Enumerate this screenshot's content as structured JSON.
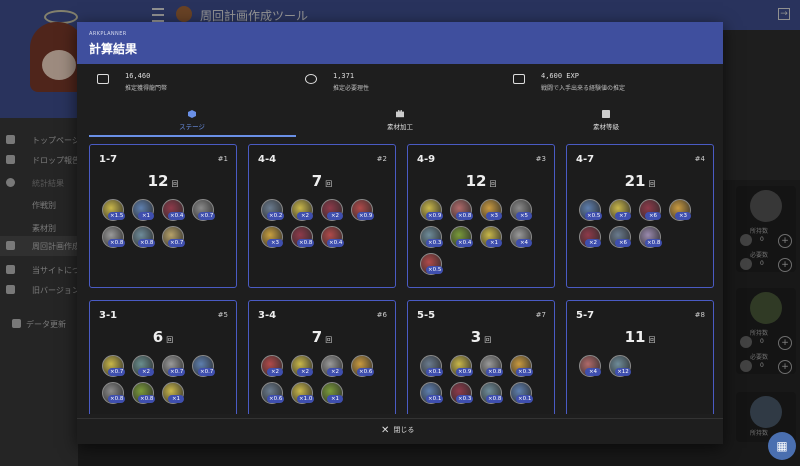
{
  "app": {
    "title": "周回計画作成ツール"
  },
  "drawer": {
    "items": [
      {
        "label": "トップページ",
        "icon": "home-icon"
      },
      {
        "label": "ドロップ報告",
        "icon": "upload-icon"
      },
      {
        "label": "統計結果",
        "icon": "pie-chart-icon"
      },
      {
        "label": "作戦別",
        "icon": ""
      },
      {
        "label": "素材別",
        "icon": ""
      },
      {
        "label": "周回計画作成ツ",
        "icon": "calculator-icon"
      },
      {
        "label": "当サイトについ",
        "icon": "people-icon"
      },
      {
        "label": "旧バージョン",
        "icon": "history-icon"
      },
      {
        "label": "データ更新",
        "icon": "database-icon"
      }
    ]
  },
  "right_panel": {
    "owned_label": "所持数",
    "required_label": "必要数",
    "value": "0"
  },
  "dialog": {
    "brand": "ARKPLANNER",
    "title": "計算結果",
    "stats": [
      {
        "value": "16,460",
        "label": "推定獲得龍門幣",
        "icon": "money-icon"
      },
      {
        "value": "1,371",
        "label": "推定必要理性",
        "icon": "sanity-icon"
      },
      {
        "value": "4,600 EXP",
        "label": "戦闘で入手出来る経験値の推定",
        "icon": "exp-icon"
      }
    ],
    "tabs": [
      {
        "label": "ステージ",
        "icon": "cube-icon"
      },
      {
        "label": "素材加工",
        "icon": "toolbox-icon"
      },
      {
        "label": "素材等級",
        "icon": "grade-icon"
      }
    ],
    "times_unit": "回",
    "stages": [
      {
        "code": "1-7",
        "index": "#1",
        "count": "12",
        "drops": [
          {
            "badge": "×1.5",
            "color": "#c9b74a"
          },
          {
            "badge": "×1",
            "color": "#5e7fae"
          },
          {
            "badge": "×0.4",
            "color": "#8e3a4a"
          },
          {
            "badge": "×0.7",
            "color": "#8a8a8a"
          },
          {
            "badge": "×0.8",
            "color": "#9a9a9a"
          },
          {
            "badge": "×0.8",
            "color": "#6f8c9a"
          },
          {
            "badge": "×0.7",
            "color": "#b7a26a"
          }
        ]
      },
      {
        "code": "4-4",
        "index": "#2",
        "count": "7",
        "drops": [
          {
            "badge": "×0.2",
            "color": "#6a7b8e"
          },
          {
            "badge": "×2",
            "color": "#c9b74a"
          },
          {
            "badge": "×2",
            "color": "#8e3a4a"
          },
          {
            "badge": "×0.9",
            "color": "#b04a4a"
          },
          {
            "badge": "×3",
            "color": "#c9a040"
          },
          {
            "badge": "×0.8",
            "color": "#8e3a4a"
          },
          {
            "badge": "×0.4",
            "color": "#b04a4a"
          }
        ]
      },
      {
        "code": "4-9",
        "index": "#3",
        "count": "12",
        "drops": [
          {
            "badge": "×0.9",
            "color": "#c9b74a"
          },
          {
            "badge": "×0.8",
            "color": "#b06a6a"
          },
          {
            "badge": "×3",
            "color": "#c99a40"
          },
          {
            "badge": "×5",
            "color": "#8a8a8a"
          },
          {
            "badge": "×0.3",
            "color": "#6f8c9a"
          },
          {
            "badge": "×0.4",
            "color": "#7a9a3a"
          },
          {
            "badge": "×1",
            "color": "#c9b74a"
          },
          {
            "badge": "×4",
            "color": "#9a9a9a"
          },
          {
            "badge": "×0.5",
            "color": "#b04a4a"
          }
        ]
      },
      {
        "code": "4-7",
        "index": "#4",
        "count": "21",
        "drops": [
          {
            "badge": "×0.5",
            "color": "#5e7fae"
          },
          {
            "badge": "×7",
            "color": "#c9b74a"
          },
          {
            "badge": "×6",
            "color": "#8e3a4a"
          },
          {
            "badge": "×3",
            "color": "#c99a40"
          },
          {
            "badge": "×2",
            "color": "#8e3a4a"
          },
          {
            "badge": "×6",
            "color": "#6a7b8e"
          },
          {
            "badge": "×0.8",
            "color": "#9a8aae"
          }
        ]
      },
      {
        "code": "3-1",
        "index": "#5",
        "count": "6",
        "drops": [
          {
            "badge": "×0.7",
            "color": "#c9b74a"
          },
          {
            "badge": "×2",
            "color": "#6a8e8e"
          },
          {
            "badge": "×0.7",
            "color": "#9a9a9a"
          },
          {
            "badge": "×0.7",
            "color": "#5e7fae"
          },
          {
            "badge": "×0.8",
            "color": "#8a8a8a"
          },
          {
            "badge": "×0.8",
            "color": "#7a9a3a"
          },
          {
            "badge": "×1",
            "color": "#c9b74a"
          }
        ]
      },
      {
        "code": "3-4",
        "index": "#6",
        "count": "7",
        "drops": [
          {
            "badge": "×2",
            "color": "#b04a4a"
          },
          {
            "badge": "×2",
            "color": "#c9b74a"
          },
          {
            "badge": "×2",
            "color": "#9a9a9a"
          },
          {
            "badge": "×0.6",
            "color": "#c99a40"
          },
          {
            "badge": "×0.6",
            "color": "#6a7b8e"
          },
          {
            "badge": "×1.0",
            "color": "#c9b74a"
          },
          {
            "badge": "×1",
            "color": "#7a9a3a"
          }
        ]
      },
      {
        "code": "5-5",
        "index": "#7",
        "count": "3",
        "drops": [
          {
            "badge": "×0.1",
            "color": "#6a7b8e"
          },
          {
            "badge": "×0.9",
            "color": "#c9b74a"
          },
          {
            "badge": "×0.8",
            "color": "#9a9a9a"
          },
          {
            "badge": "×0.3",
            "color": "#c99a40"
          },
          {
            "badge": "×0.1",
            "color": "#5e7fae"
          },
          {
            "badge": "×0.3",
            "color": "#8e3a4a"
          },
          {
            "badge": "×0.8",
            "color": "#6f8c9a"
          },
          {
            "badge": "×0.1",
            "color": "#5e7fae"
          }
        ]
      },
      {
        "code": "5-7",
        "index": "#8",
        "count": "11",
        "drops": [
          {
            "badge": "×4",
            "color": "#b06a6a"
          },
          {
            "badge": "×12",
            "color": "#6f8c9a"
          }
        ]
      }
    ],
    "close_label": "閉じる"
  }
}
